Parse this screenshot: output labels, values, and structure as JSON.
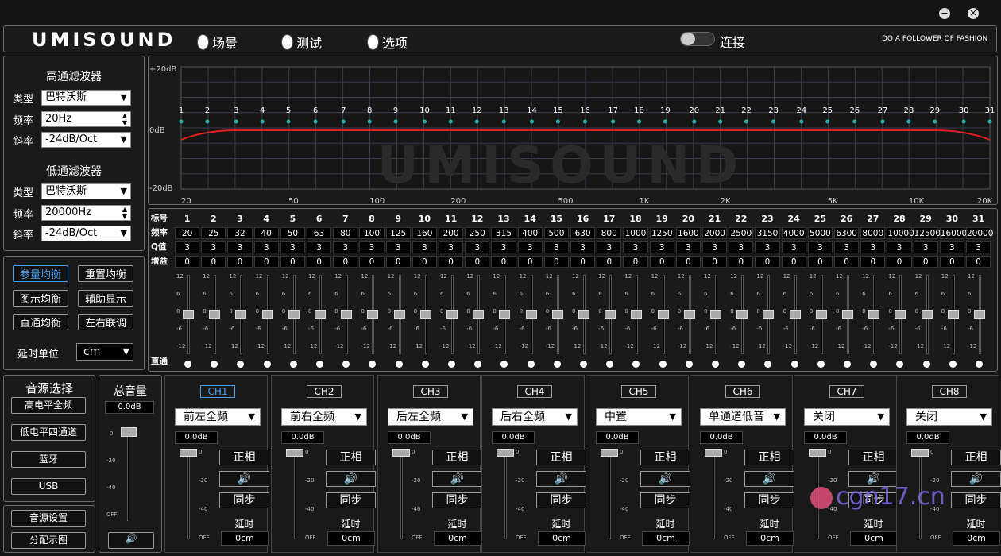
{
  "window": {
    "minimize": "−",
    "close": "✕"
  },
  "brand": {
    "logo": "UMISOUND",
    "slogan": "DO A FOLLOWER OF FASHION"
  },
  "menu": [
    {
      "label": "场景",
      "selected": true
    },
    {
      "label": "测试",
      "selected": true
    },
    {
      "label": "选项",
      "selected": true
    }
  ],
  "connect": {
    "label": "连接"
  },
  "hpf": {
    "title": "高通滤波器",
    "type_label": "类型",
    "type_value": "巴特沃斯",
    "freq_label": "频率",
    "freq_value": "20Hz",
    "slope_label": "斜率",
    "slope_value": "-24dB/Oct"
  },
  "lpf": {
    "title": "低通滤波器",
    "type_label": "类型",
    "type_value": "巴特沃斯",
    "freq_label": "频率",
    "freq_value": "20000Hz",
    "slope_label": "斜率",
    "slope_value": "-24dB/Oct"
  },
  "eqbtns": {
    "param": "参量均衡",
    "reset": "重置均衡",
    "graphic": "图示均衡",
    "assist": "辅助显示",
    "bypass": "直通均衡",
    "link": "左右联调"
  },
  "delay_unit": {
    "label": "延时单位",
    "value": "cm"
  },
  "graph": {
    "ylabels": [
      "+20dB",
      "0dB",
      "-20dB"
    ],
    "xlabels": [
      "20",
      "50",
      "100",
      "200",
      "500",
      "1K",
      "2K",
      "5K",
      "10K",
      "20K"
    ],
    "points": [
      "1",
      "2",
      "3",
      "4",
      "5",
      "6",
      "7",
      "8",
      "9",
      "10",
      "11",
      "12",
      "13",
      "14",
      "15",
      "16",
      "17",
      "18",
      "19",
      "20",
      "21",
      "22",
      "23",
      "24",
      "25",
      "26",
      "27",
      "28",
      "29",
      "30",
      "31"
    ],
    "watermark": "UMISOUND",
    "curve_color": "#e02020",
    "point_color": "#2ab0b0"
  },
  "table": {
    "row_labels": [
      "标号",
      "频率",
      "Q值",
      "增益"
    ],
    "bypass_label": "直通",
    "freq": [
      "20",
      "25",
      "32",
      "40",
      "50",
      "63",
      "80",
      "100",
      "125",
      "160",
      "200",
      "250",
      "315",
      "400",
      "500",
      "630",
      "800",
      "1000",
      "1250",
      "1600",
      "2000",
      "2500",
      "3150",
      "4000",
      "5000",
      "6300",
      "8000",
      "10000",
      "12500",
      "16000",
      "20000"
    ],
    "q": "3",
    "gain": "0"
  },
  "slider_ticks": [
    "12",
    "6",
    "0",
    "-6",
    "-12"
  ],
  "source": {
    "title": "音源选择",
    "items": [
      "高电平全频",
      "低电平四通道",
      "蓝牙",
      "USB"
    ],
    "setup": "音源设置",
    "routing": "分配示图"
  },
  "master": {
    "title": "总音量",
    "value": "0.0dB",
    "ticks": [
      "0",
      "-20",
      "-40",
      "OFF"
    ],
    "mute": "🔊"
  },
  "channels": [
    {
      "name": "CH1",
      "source": "前左全频",
      "active": true
    },
    {
      "name": "CH2",
      "source": "前右全频"
    },
    {
      "name": "CH3",
      "source": "后左全频"
    },
    {
      "name": "CH4",
      "source": "后右全频"
    },
    {
      "name": "CH5",
      "source": "中置"
    },
    {
      "name": "CH6",
      "source": "单通道低音"
    },
    {
      "name": "CH7",
      "source": "关闭"
    },
    {
      "name": "CH8",
      "source": "关闭"
    }
  ],
  "ch_common": {
    "gain": "0.0dB",
    "phase": "正相",
    "mute": "🔊",
    "sync": "同步",
    "delay_label": "延时",
    "delay": "0cm",
    "ticks": [
      "0",
      "-20",
      "-40",
      "OFF"
    ]
  },
  "site_watermark": "cgn17.cn"
}
